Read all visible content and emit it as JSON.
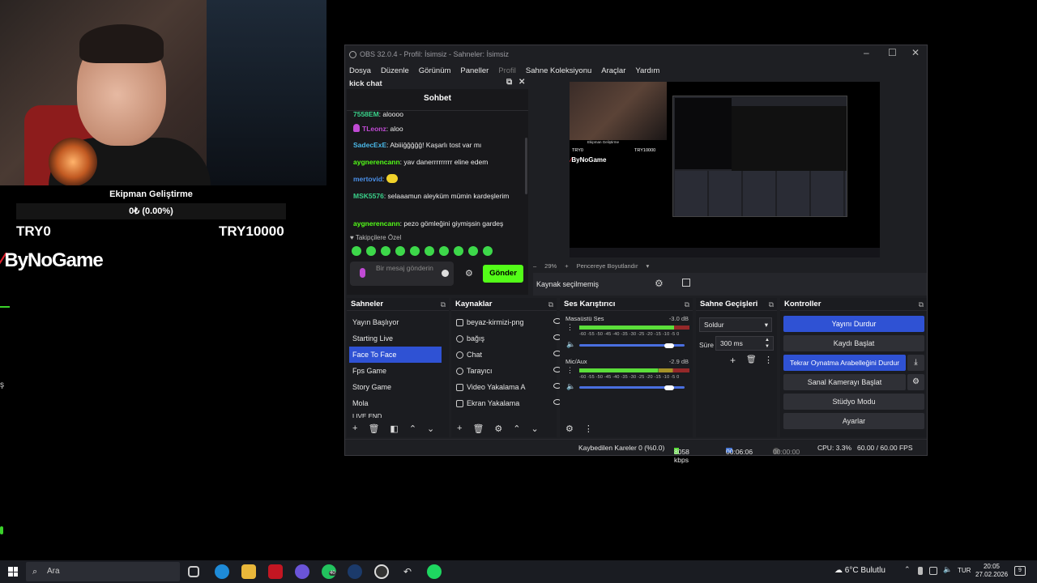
{
  "overlay": {
    "goal_title": "Ekipman Geliştirme",
    "goal_progress": "0₺ (0.00%)",
    "goal_min": "TRY0",
    "goal_max": "TRY10000",
    "brand": "ByNoGame",
    "side_text": "ş"
  },
  "obs": {
    "title": "OBS 32.0.4 - Profil: İsimsiz - Sahneler: İsimsiz",
    "menu": [
      "Dosya",
      "Düzenle",
      "Görünüm",
      "Paneller",
      "Profil",
      "Sahne Koleksiyonu",
      "Araçlar",
      "Yardım"
    ],
    "chat": {
      "dock_title": "kick chat",
      "header": "Sohbet",
      "messages": [
        {
          "user": "7558EM",
          "text": ": aloooo",
          "color": "#3ad18a"
        },
        {
          "user": "TLeonz",
          "text": ": aloo",
          "color": "#c04ad4"
        },
        {
          "user": "SadecExE",
          "text": ": Abiiiğğğğğ! Kaşarlı tost var mı",
          "color": "#4ab8e8"
        },
        {
          "user": "aygnerencann",
          "text": ": yav danerrrrrrrrr eline edem",
          "color": "#53fc18"
        },
        {
          "user": "mertovid",
          "text": ": ",
          "color": "#4a8fe8"
        },
        {
          "user": "MSK5576",
          "text": ": selaaamun aleyküm mümin kardeşlerim",
          "color": "#3ad18a"
        },
        {
          "user": "aygnerencann",
          "text": ": pezo gömleğini giymişsin gardeş",
          "color": "#53fc18"
        }
      ],
      "followers_label": "♥ Takipçilere Özel",
      "input_placeholder": "Bir mesaj gönderin",
      "send_label": "Gönder"
    },
    "zoom": "29%",
    "fit_label": "Pencereye Boyutlandır",
    "no_source": "Kaynak seçilmemiş",
    "preview": {
      "title": "Ekipman Geliştirme",
      "progress": "0₺ (0.00%)",
      "min": "TRY0",
      "max": "TRY10000",
      "brand": "ByNoGame"
    },
    "scenes": {
      "title": "Sahneler",
      "items": [
        "Yayın Başlıyor",
        "Starting Live",
        "Face To Face",
        "Fps Game",
        "Story Game",
        "Mola",
        "LIVE END"
      ],
      "selected": "Face To Face"
    },
    "sources": {
      "title": "Kaynaklar",
      "items": [
        "beyaz-kirmizi-png",
        "bağış",
        "Chat",
        "Tarayıcı",
        "Video Yakalama A",
        "Ekran Yakalama"
      ]
    },
    "mixer": {
      "title": "Ses Karıştırıcı",
      "channels": [
        {
          "name": "Masaüstü Ses",
          "db": "-3.0 dB",
          "level": 0.86
        },
        {
          "name": "Mic/Aux",
          "db": "-2.9 dB",
          "level": 0.71
        }
      ],
      "scale": "-60 -55 -50 -45 -40 -35 -30 -25 -20 -15 -10 -5 0"
    },
    "transitions": {
      "title": "Sahne Geçişleri",
      "type": "Soldur",
      "duration_label": "Süre",
      "duration": "300 ms"
    },
    "controls": {
      "title": "Kontroller",
      "stop_stream": "Yayını Durdur",
      "start_record": "Kaydı Başlat",
      "stop_replay": "Tekrar Oynatma Arabelleğini Durdur",
      "virtual_cam": "Sanal Kamerayı Başlat",
      "studio": "Stüdyo Modu",
      "settings": "Ayarlar"
    },
    "status": {
      "dropped": "Kaybedilen Kareler 0 (%0.0)",
      "bitrate": "8058 kbps",
      "live_time": "00:06:06",
      "rec_time": "00:00:00",
      "cpu": "CPU: 3.3%",
      "fps": "60.00 / 60.00 FPS"
    }
  },
  "taskbar": {
    "search": "Ara",
    "weather": "6°C  Bulutlu",
    "lang": "TUR",
    "time": "20:05",
    "date": "27.02.2026",
    "notifications": "9",
    "whatsapp_badge": "40"
  }
}
